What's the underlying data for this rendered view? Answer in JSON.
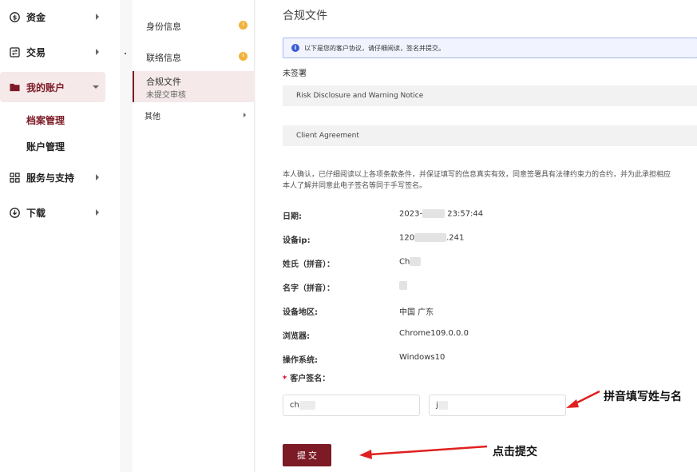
{
  "nav": {
    "items": [
      {
        "label": "资金",
        "icon": "dollar-circle-icon"
      },
      {
        "label": "交易",
        "icon": "exchange-icon"
      },
      {
        "label": "我的账户",
        "icon": "folder-icon"
      },
      {
        "label": "服务与支持",
        "icon": "grid-icon"
      },
      {
        "label": "下载",
        "icon": "download-icon"
      }
    ],
    "sub_items": [
      {
        "label": "档案管理"
      },
      {
        "label": "账户管理"
      }
    ]
  },
  "mid": {
    "identity": "身份信息",
    "contact": "联络信息",
    "compliance": "合规文件",
    "compliance_status": "未提交审核",
    "other": "其他"
  },
  "content": {
    "title": "合规文件",
    "info_text": "以下是您的客户协议，请仔细阅读，签名并提交。",
    "unsigned": "未签署",
    "docs": [
      "Risk Disclosure and Warning Notice",
      "Client Agreement"
    ],
    "consent_line1": "本人确认，已仔细阅读以上各项条款条件，并保证填写的信息真实有效，同意签署具有法律约束力的合约，并为此承担相应",
    "consent_line2": "本人了解并同意此电子签名等同于手写签名。",
    "fields": {
      "date_label": "日期:",
      "date_prefix": "2023-",
      "date_suffix": " 23:57:44",
      "ip_label": "设备ip:",
      "ip_prefix": "120",
      "ip_suffix": ".241",
      "surname_label": "姓氏（拼音）：",
      "surname_prefix": "Ch",
      "given_label": "名字（拼音）：",
      "region_label": "设备地区:",
      "region_value": "中国 广东",
      "browser_label": "浏览器:",
      "browser_value": "Chrome109.0.0.0",
      "os_label": "操作系统:",
      "os_value": "Windows10"
    },
    "signature_label": "客户签名：",
    "signature_required_mark": "*",
    "signature_surname": "ch",
    "signature_given": "j",
    "submit_label": "提 交"
  },
  "annotations": {
    "pinyin_note": "拼音填写姓与名",
    "click_note": "点击提交"
  },
  "colors": {
    "brand": "#7c1a25",
    "pending": "#f2b33d",
    "info_blue": "#3b5bdb",
    "arrow_red": "#e02020"
  }
}
